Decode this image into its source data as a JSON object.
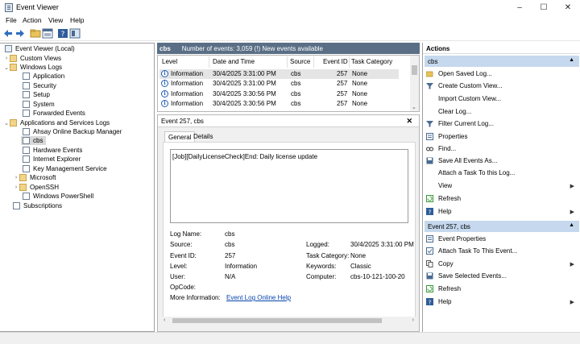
{
  "window": {
    "title": "Event Viewer",
    "controls": {
      "minimize": "–",
      "maximize": "☐",
      "close": "✕"
    }
  },
  "menu": [
    "File",
    "Action",
    "View",
    "Help"
  ],
  "toolbar": {
    "buttons": [
      "back-icon",
      "forward-icon",
      "folder-icon",
      "properties-icon",
      "help-icon",
      "show-hide-icon"
    ]
  },
  "tree": {
    "items": [
      {
        "label": "Event Viewer (Local)",
        "expander": "",
        "icon": "event-viewer"
      },
      {
        "label": "Custom Views",
        "expander": "›",
        "icon": "folder"
      },
      {
        "label": "Windows Logs",
        "expander": "⌄",
        "icon": "folder"
      },
      {
        "label": "Application",
        "expander": "",
        "icon": "log"
      },
      {
        "label": "Security",
        "expander": "",
        "icon": "log"
      },
      {
        "label": "Setup",
        "expander": "",
        "icon": "log"
      },
      {
        "label": "System",
        "expander": "",
        "icon": "log"
      },
      {
        "label": "Forwarded Events",
        "expander": "",
        "icon": "log"
      },
      {
        "label": "Applications and Services Logs",
        "expander": "⌄",
        "icon": "folder"
      },
      {
        "label": "Ahsay Online Backup Manager",
        "expander": "",
        "icon": "log"
      },
      {
        "label": "cbs",
        "expander": "",
        "icon": "log"
      },
      {
        "label": "Hardware Events",
        "expander": "",
        "icon": "log"
      },
      {
        "label": "Internet Explorer",
        "expander": "",
        "icon": "log"
      },
      {
        "label": "Key Management Service",
        "expander": "",
        "icon": "log"
      },
      {
        "label": "Microsoft",
        "expander": "›",
        "icon": "folder"
      },
      {
        "label": "OpenSSH",
        "expander": "›",
        "icon": "folder"
      },
      {
        "label": "Windows PowerShell",
        "expander": "",
        "icon": "log"
      },
      {
        "label": "Subscriptions",
        "expander": "",
        "icon": "log"
      }
    ]
  },
  "center": {
    "log_name": "cbs",
    "summary": "Number of events: 3,059 (!) New events available",
    "columns": [
      "Level",
      "Date and Time",
      "Source",
      "Event ID",
      "Task Category"
    ],
    "rows": [
      {
        "level": "Information",
        "datetime": "30/4/2025 3:31:00 PM",
        "source": "cbs",
        "event_id": "257",
        "task": "None"
      },
      {
        "level": "Information",
        "datetime": "30/4/2025 3:31:00 PM",
        "source": "cbs",
        "event_id": "257",
        "task": "None"
      },
      {
        "level": "Information",
        "datetime": "30/4/2025 3:30:56 PM",
        "source": "cbs",
        "event_id": "257",
        "task": "None"
      },
      {
        "level": "Information",
        "datetime": "30/4/2025 3:30:56 PM",
        "source": "cbs",
        "event_id": "257",
        "task": "None"
      }
    ]
  },
  "detail": {
    "title": "Event 257, cbs",
    "close": "✕",
    "tabs": [
      "General",
      "Details"
    ],
    "message": "[Job][DailyLicenseCheck]End: Daily license update",
    "fields": {
      "log_name_label": "Log Name:",
      "log_name": "cbs",
      "source_label": "Source:",
      "source": "cbs",
      "logged_label": "Logged:",
      "logged": "30/4/2025 3:31:00 PM",
      "event_id_label": "Event ID:",
      "event_id": "257",
      "task_label": "Task Category:",
      "task": "None",
      "level_label": "Level:",
      "level": "Information",
      "keywords_label": "Keywords:",
      "keywords": "Classic",
      "user_label": "User:",
      "user": "N/A",
      "computer_label": "Computer:",
      "computer": "cbs-10-121-100-20",
      "opcode_label": "OpCode:",
      "opcode": "",
      "more_info_label": "More Information:",
      "more_info": "Event Log Online Help"
    }
  },
  "actions": {
    "header": "Actions",
    "group1_title": "cbs",
    "group1": [
      {
        "label": "Open Saved Log...",
        "icon": "open-log",
        "submenu": false
      },
      {
        "label": "Create Custom View...",
        "icon": "filter",
        "submenu": false
      },
      {
        "label": "Import Custom View...",
        "icon": "",
        "submenu": false
      },
      {
        "label": "Clear Log...",
        "icon": "",
        "submenu": false
      },
      {
        "label": "Filter Current Log...",
        "icon": "filter",
        "submenu": false
      },
      {
        "label": "Properties",
        "icon": "properties",
        "submenu": false
      },
      {
        "label": "Find...",
        "icon": "find",
        "submenu": false
      },
      {
        "label": "Save All Events As...",
        "icon": "save",
        "submenu": false
      },
      {
        "label": "Attach a Task To this Log...",
        "icon": "",
        "submenu": false
      },
      {
        "label": "View",
        "icon": "",
        "submenu": true
      },
      {
        "label": "Refresh",
        "icon": "refresh",
        "submenu": false
      },
      {
        "label": "Help",
        "icon": "help",
        "submenu": true
      }
    ],
    "group2_title": "Event 257, cbs",
    "group2": [
      {
        "label": "Event Properties",
        "icon": "properties",
        "submenu": false
      },
      {
        "label": "Attach Task To This Event...",
        "icon": "task",
        "submenu": false
      },
      {
        "label": "Copy",
        "icon": "copy",
        "submenu": true
      },
      {
        "label": "Save Selected Events...",
        "icon": "save",
        "submenu": false
      },
      {
        "label": "Refresh",
        "icon": "refresh",
        "submenu": false
      },
      {
        "label": "Help",
        "icon": "help",
        "submenu": true
      }
    ]
  }
}
